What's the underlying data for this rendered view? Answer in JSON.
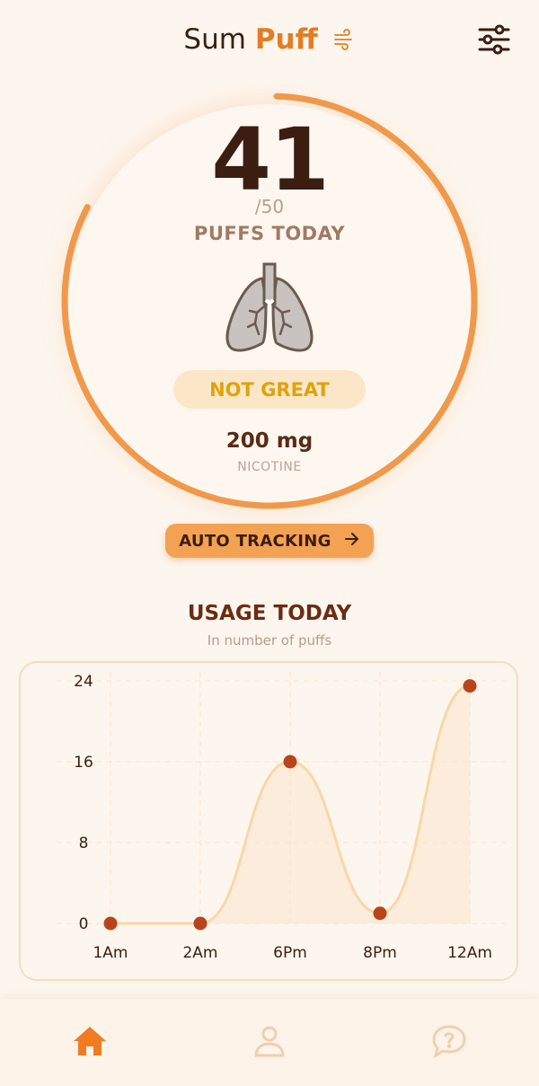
{
  "header": {
    "brand_part1": "Sum",
    "brand_part2": "Puff",
    "brand_icon": "wind-icon",
    "settings_icon": "sliders-icon"
  },
  "tracker": {
    "count": "41",
    "limit": "/50",
    "label": "PUFFS TODAY",
    "progress_fraction": 0.82,
    "lungs_icon": "lungs-icon",
    "status": "NOT GREAT",
    "nicotine_value": "200 mg",
    "nicotine_label": "NICOTINE"
  },
  "auto_tracking": {
    "label": "AUTO TRACKING",
    "icon": "arrow-right-icon"
  },
  "usage": {
    "title": "USAGE TODAY",
    "subtitle": "In number of puffs"
  },
  "chart_data": {
    "type": "area",
    "title": "USAGE TODAY",
    "subtitle": "In number of puffs",
    "categories": [
      "1Am",
      "2Am",
      "6Pm",
      "8Pm",
      "12Am"
    ],
    "values": [
      0,
      0,
      16,
      1,
      23.5
    ],
    "y_ticks": [
      0,
      8,
      16,
      24
    ],
    "ylim": [
      0,
      24
    ],
    "grid": true,
    "colors": {
      "line": "#f8d7a8",
      "fill": "#f9e4cc",
      "point": "#b9441b"
    }
  },
  "nav": {
    "items": [
      {
        "icon": "home-icon",
        "active": true
      },
      {
        "icon": "user-icon",
        "active": false
      },
      {
        "icon": "help-bubble-icon",
        "active": false
      }
    ]
  },
  "colors": {
    "accent": "#f0994a",
    "background": "#fdf6ee",
    "dark_text": "#3b1d12",
    "status_text": "#e0a20c",
    "status_bg": "#fbe7c8"
  }
}
